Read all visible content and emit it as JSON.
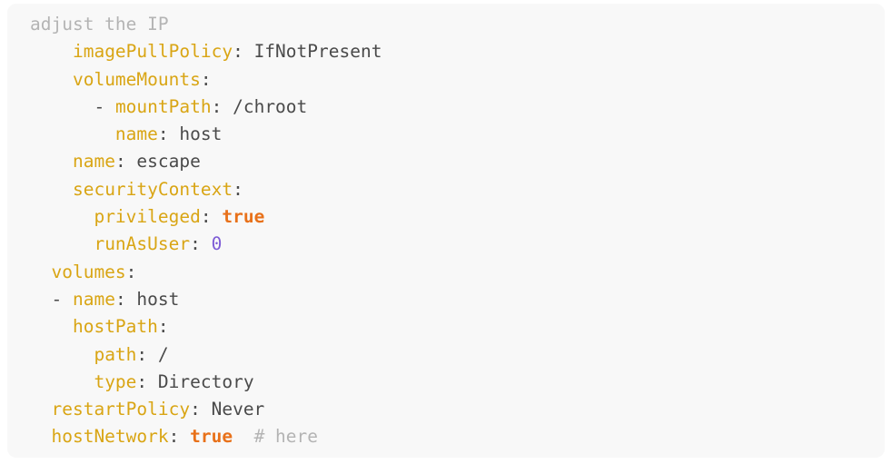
{
  "panel": {
    "language": "yaml",
    "background_color": "#f8f8f8",
    "page_background_color": "#ffffff",
    "corner_radius_px": 10
  },
  "theme": {
    "key_color": "#d9a514",
    "plain_color": "#4a4a4a",
    "punctuation_color": "#4a4a4a",
    "boolean_color": "#e8711a",
    "number_color": "#7d5bd6",
    "comment_color": "#b4b4b4"
  },
  "code": {
    "lines": [
      {
        "index": 0,
        "indent": "",
        "text": "adjust the IP",
        "tokens": [
          {
            "type": "comment",
            "text": "adjust the IP"
          }
        ]
      },
      {
        "index": 1,
        "indent": "    ",
        "text": "    imagePullPolicy: IfNotPresent",
        "tokens": [
          {
            "type": "indent",
            "text": "    "
          },
          {
            "type": "key",
            "text": "imagePullPolicy"
          },
          {
            "type": "punct",
            "text": ": "
          },
          {
            "type": "plain",
            "text": "IfNotPresent"
          }
        ]
      },
      {
        "index": 2,
        "indent": "    ",
        "text": "    volumeMounts:",
        "tokens": [
          {
            "type": "indent",
            "text": "    "
          },
          {
            "type": "key",
            "text": "volumeMounts"
          },
          {
            "type": "punct",
            "text": ":"
          }
        ]
      },
      {
        "index": 3,
        "indent": "      ",
        "text": "      - mountPath: /chroot",
        "tokens": [
          {
            "type": "indent",
            "text": "      "
          },
          {
            "type": "dash",
            "text": "- "
          },
          {
            "type": "key",
            "text": "mountPath"
          },
          {
            "type": "punct",
            "text": ": "
          },
          {
            "type": "plain",
            "text": "/chroot"
          }
        ]
      },
      {
        "index": 4,
        "indent": "        ",
        "text": "        name: host",
        "tokens": [
          {
            "type": "indent",
            "text": "        "
          },
          {
            "type": "key",
            "text": "name"
          },
          {
            "type": "punct",
            "text": ": "
          },
          {
            "type": "plain",
            "text": "host"
          }
        ]
      },
      {
        "index": 5,
        "indent": "    ",
        "text": "    name: escape",
        "tokens": [
          {
            "type": "indent",
            "text": "    "
          },
          {
            "type": "key",
            "text": "name"
          },
          {
            "type": "punct",
            "text": ": "
          },
          {
            "type": "plain",
            "text": "escape"
          }
        ]
      },
      {
        "index": 6,
        "indent": "    ",
        "text": "    securityContext:",
        "tokens": [
          {
            "type": "indent",
            "text": "    "
          },
          {
            "type": "key",
            "text": "securityContext"
          },
          {
            "type": "punct",
            "text": ":"
          }
        ]
      },
      {
        "index": 7,
        "indent": "      ",
        "text": "      privileged: true",
        "tokens": [
          {
            "type": "indent",
            "text": "      "
          },
          {
            "type": "key",
            "text": "privileged"
          },
          {
            "type": "punct",
            "text": ": "
          },
          {
            "type": "bool",
            "text": "true"
          }
        ]
      },
      {
        "index": 8,
        "indent": "      ",
        "text": "      runAsUser: 0",
        "tokens": [
          {
            "type": "indent",
            "text": "      "
          },
          {
            "type": "key",
            "text": "runAsUser"
          },
          {
            "type": "punct",
            "text": ": "
          },
          {
            "type": "number",
            "text": "0"
          }
        ]
      },
      {
        "index": 9,
        "indent": "  ",
        "text": "  volumes:",
        "tokens": [
          {
            "type": "indent",
            "text": "  "
          },
          {
            "type": "key",
            "text": "volumes"
          },
          {
            "type": "punct",
            "text": ":"
          }
        ]
      },
      {
        "index": 10,
        "indent": "  ",
        "text": "  - name: host",
        "tokens": [
          {
            "type": "indent",
            "text": "  "
          },
          {
            "type": "dash",
            "text": "- "
          },
          {
            "type": "key",
            "text": "name"
          },
          {
            "type": "punct",
            "text": ": "
          },
          {
            "type": "plain",
            "text": "host"
          }
        ]
      },
      {
        "index": 11,
        "indent": "    ",
        "text": "    hostPath:",
        "tokens": [
          {
            "type": "indent",
            "text": "    "
          },
          {
            "type": "key",
            "text": "hostPath"
          },
          {
            "type": "punct",
            "text": ":"
          }
        ]
      },
      {
        "index": 12,
        "indent": "      ",
        "text": "      path: /",
        "tokens": [
          {
            "type": "indent",
            "text": "      "
          },
          {
            "type": "key",
            "text": "path"
          },
          {
            "type": "punct",
            "text": ": "
          },
          {
            "type": "plain",
            "text": "/"
          }
        ]
      },
      {
        "index": 13,
        "indent": "      ",
        "text": "      type: Directory",
        "tokens": [
          {
            "type": "indent",
            "text": "      "
          },
          {
            "type": "key",
            "text": "type"
          },
          {
            "type": "punct",
            "text": ": "
          },
          {
            "type": "plain",
            "text": "Directory"
          }
        ]
      },
      {
        "index": 14,
        "indent": "  ",
        "text": "  restartPolicy: Never",
        "tokens": [
          {
            "type": "indent",
            "text": "  "
          },
          {
            "type": "key",
            "text": "restartPolicy"
          },
          {
            "type": "punct",
            "text": ": "
          },
          {
            "type": "plain",
            "text": "Never"
          }
        ]
      },
      {
        "index": 15,
        "indent": "  ",
        "text": "  hostNetwork: true  # here",
        "tokens": [
          {
            "type": "indent",
            "text": "  "
          },
          {
            "type": "key",
            "text": "hostNetwork"
          },
          {
            "type": "punct",
            "text": ": "
          },
          {
            "type": "bool",
            "text": "true"
          },
          {
            "type": "plain",
            "text": "  "
          },
          {
            "type": "comment",
            "text": "# here"
          }
        ]
      }
    ]
  }
}
